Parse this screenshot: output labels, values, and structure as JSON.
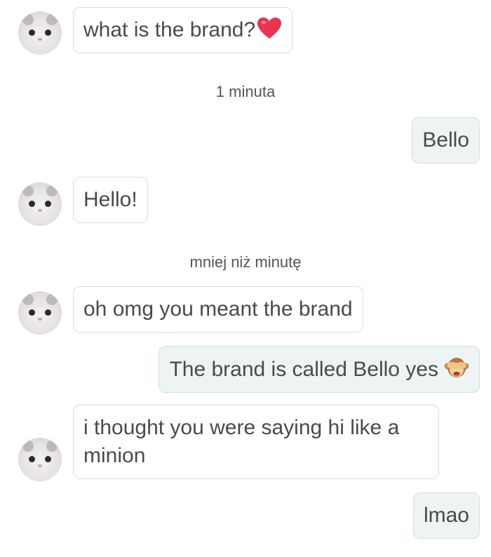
{
  "messages": [
    {
      "side": "in",
      "text": "what is the brand?",
      "icon": "red-heart-emoji"
    },
    {
      "timestamp": "1 minuta"
    },
    {
      "side": "out",
      "text": "Bello"
    },
    {
      "side": "in",
      "text": "Hello!"
    },
    {
      "timestamp": "mniej niż minutę"
    },
    {
      "side": "in",
      "text": "oh omg you meant the brand"
    },
    {
      "side": "out",
      "text": "The brand is called Bello yes",
      "icon": "see-no-evil-monkey-emoji"
    },
    {
      "side": "in",
      "text": "i thought you were saying hi like a minion"
    },
    {
      "side": "out",
      "text": "lmao"
    }
  ],
  "colors": {
    "incoming_bubble": "#ffffff",
    "outgoing_bubble": "#eef4f4",
    "heart": "#e8344e"
  }
}
